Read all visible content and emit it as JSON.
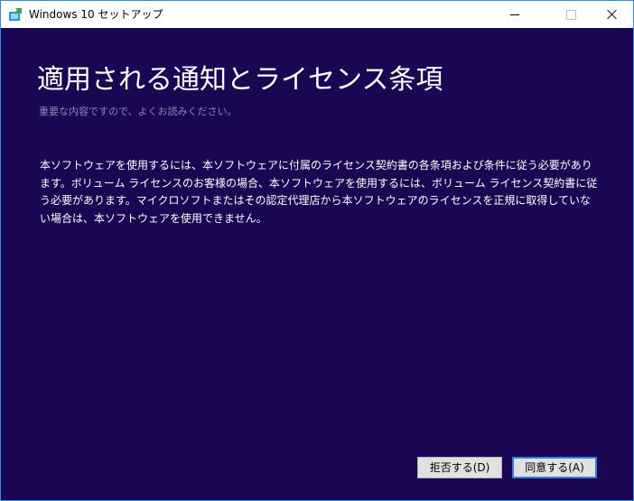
{
  "window": {
    "title": "Windows 10 セットアップ"
  },
  "header": {
    "title": "適用される通知とライセンス条項",
    "subtitle": "重要な内容ですので、よくお読みください。"
  },
  "license": {
    "text": "本ソフトウェアを使用するには、本ソフトウェアに付属のライセンス契約書の各条項および条件に従う必要があります。ボリューム ライセンスのお客様の場合、本ソフトウェアを使用するには、ボリューム ライセンス契約書に従う必要があります。マイクロソフトまたはその認定代理店から本ソフトウェアのライセンスを正規に取得していない場合は、本ソフトウェアを使用できません。"
  },
  "buttons": {
    "decline": "拒否する(D)",
    "accept": "同意する(A)"
  },
  "icons": {
    "app": "windows-setup-icon",
    "minimize": "minimize-icon",
    "maximize": "maximize-icon",
    "close": "close-icon"
  },
  "colors": {
    "background": "#1a0652",
    "accent": "#2f7fdc"
  }
}
